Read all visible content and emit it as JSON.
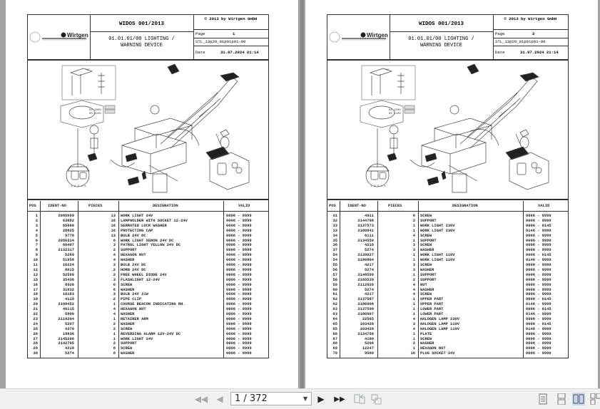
{
  "viewer": {
    "page_indicator": "1 / 372",
    "buttons": {
      "first": "first-page",
      "prev": "previous-page",
      "next": "next-page",
      "last": "last-page"
    }
  },
  "header": {
    "doc_title": "WIDOS 001/2013",
    "copyright": "© 2013 by Wirtgen GmbH",
    "section_line1": "01.01.01/00 LIGHTING /",
    "section_line2": "WARNING DEVICE",
    "page_label": "Page",
    "stl": "STL_13p20_01p01p01-00",
    "date_label": "Date",
    "date_value": "31.07.2024  21:14",
    "logo_text": "Wirtgen"
  },
  "table_headers": {
    "pos": "POS",
    "ident": "IDENT-NO",
    "pieces": "PIECES",
    "designation": "DESIGNATION",
    "valid": "VALID"
  },
  "pages": [
    {
      "page_no": "1",
      "rows": [
        [
          "1",
          "2085099",
          "13",
          "WORK LIGHT 24V",
          "0006 - 9999"
        ],
        [
          "2",
          "63882",
          "16",
          "LAMPHOLDER WITH SOCKET 12-24V",
          "0006 - 9999"
        ],
        [
          "3",
          "65068",
          "16",
          "SERRATED LOCK WASHER",
          "0006 - 9999"
        ],
        [
          "4",
          "28825",
          "16",
          "PROTECTING CAP",
          "0006 - 9999"
        ],
        [
          "5",
          "9778",
          "13",
          "BULB 24V DC",
          "0006 - 9999"
        ],
        [
          "6",
          "2050314",
          "6",
          "WORK LIGHT XENON 24V DC",
          "0006 - 9999"
        ],
        [
          "7",
          "68407",
          "3",
          "PATROL LIGHT YELLOW 24V DC",
          "0006 - 9999"
        ],
        [
          "8",
          "2132317",
          "2",
          "SUPPORT",
          "0006 - 9999"
        ],
        [
          "9",
          "5269",
          "4",
          "HEXAGON NUT",
          "0006 - 9999"
        ],
        [
          "10",
          "51958",
          "4",
          "WASHER",
          "0006 - 9999"
        ],
        [
          "11",
          "16224",
          "3",
          "BULB 24V DC",
          "0006 - 9999"
        ],
        [
          "12",
          "8015",
          "2",
          "HORN 24V DC",
          "0006 - 9999"
        ],
        [
          "13",
          "52599",
          "2",
          "FREE WHEEL DIODE 24V",
          "0006 - 9999"
        ],
        [
          "15",
          "35436",
          "3",
          "FLASHLIGHT 12-24V",
          "0006 - 9999"
        ],
        [
          "16",
          "8926",
          "6",
          "SCREW",
          "0006 - 9999"
        ],
        [
          "17",
          "31632",
          "6",
          "WASHER",
          "0006 - 9999"
        ],
        [
          "18",
          "10183",
          "3",
          "BULB 24V 21W",
          "0006 - 9999"
        ],
        [
          "19",
          "4119",
          "2",
          "PIPE CLIP",
          "0006 - 9999"
        ],
        [
          "20",
          "2108452",
          "1",
          "COURSE BEACON INDICATING RH.",
          "0006 - 9999"
        ],
        [
          "21",
          "46115",
          "4",
          "HEXAGON NUT",
          "0006 - 9999"
        ],
        [
          "22",
          "5800",
          "4",
          "WASHER",
          "0006 - 9999"
        ],
        [
          "23",
          "2119204",
          "1",
          "RETAINER ARM",
          "0006 - 9999"
        ],
        [
          "24",
          "5207",
          "2",
          "WASHER",
          "0006 - 9999"
        ],
        [
          "25",
          "4370",
          "2",
          "SCREW",
          "0006 - 9999"
        ],
        [
          "26",
          "19836",
          "1",
          "REVERSING ALARM 12V-24V DC",
          "0006 - 9999"
        ],
        [
          "27",
          "2145206",
          "1",
          "WORK LIGHT 24V",
          "0006 - 9999"
        ],
        [
          "28",
          "2142705",
          "2",
          "SUPPORT",
          "0006 - 9999"
        ],
        [
          "29",
          "4218",
          "8",
          "SCREW",
          "0006 - 9999"
        ],
        [
          "30",
          "5274",
          "8",
          "WASHER",
          "0006 - 9999"
        ]
      ]
    },
    {
      "page_no": "2",
      "rows": [
        [
          "31",
          "4911",
          "6",
          "SCREW",
          "0006 - 9999"
        ],
        [
          "32",
          "2144798",
          "2",
          "SUPPORT",
          "0006 - 9999"
        ],
        [
          "33",
          "2137573",
          "1",
          "WORK LIGHT 230V",
          "0006 - 0145"
        ],
        [
          "33",
          "2180841",
          "1",
          "WORK LIGHT 230V",
          "0146 - 9999"
        ],
        [
          "34",
          "6111",
          "4",
          "SCREW",
          "0006 - 9999"
        ],
        [
          "35",
          "2134550",
          "1",
          "SUPPORT",
          "0006 - 9999"
        ],
        [
          "36",
          "4218",
          "3",
          "SCREW",
          "0006 - 9999"
        ],
        [
          "37",
          "5274",
          "3",
          "WASHER",
          "0006 - 9999"
        ],
        [
          "54",
          "2139027",
          "1",
          "WORK LIGHT 110V",
          "0006 - 0145"
        ],
        [
          "54",
          "2180804",
          "1",
          "WORK LIGHT 110V",
          "0146 - 9999"
        ],
        [
          "55",
          "4217",
          "3",
          "SCREW",
          "0006 - 9999"
        ],
        [
          "56",
          "5274",
          "3",
          "WASHER",
          "0006 - 9999"
        ],
        [
          "57",
          "2148599",
          "1",
          "SUPPORT",
          "0006 - 9999"
        ],
        [
          "58",
          "2165539",
          "2",
          "SUPPORT",
          "0006 - 9999"
        ],
        [
          "59",
          "2112628",
          "4",
          "NUT",
          "0006 - 9999"
        ],
        [
          "60",
          "5274",
          "4",
          "WASHER",
          "0006 - 9999"
        ],
        [
          "61",
          "4217",
          "4",
          "SCREW",
          "0006 - 9999"
        ],
        [
          "62",
          "2137587",
          "1",
          "UPPER PART",
          "0006 - 0145"
        ],
        [
          "62",
          "2180906",
          "1",
          "UPPER PART",
          "0146 - 9999"
        ],
        [
          "63",
          "2137590",
          "1",
          "LOWER PART",
          "0006 - 0145"
        ],
        [
          "63",
          "2180907",
          "1",
          "LOWER PART",
          "0146 - 9999"
        ],
        [
          "64",
          "22565",
          "4",
          "HALOGEN LAMP 230V",
          "0006 - 9999"
        ],
        [
          "65",
          "103428",
          "3",
          "HALOGEN LAMP 110V",
          "0006 - 0145"
        ],
        [
          "65",
          "103428",
          "4",
          "HALOGEN LAMP 110V",
          "0146 - 9999"
        ],
        [
          "66",
          "2134756",
          "1",
          "PLATE",
          "0006 - 9999"
        ],
        [
          "67",
          "4180",
          "1",
          "SCREW",
          "0006 - 9999"
        ],
        [
          "68",
          "5206",
          "2",
          "WASHER",
          "0006 - 9999"
        ],
        [
          "69",
          "12247",
          "1",
          "HEXAGON NUT",
          "0006 - 9999"
        ],
        [
          "70",
          "9560",
          "16",
          "PLUG SOCKET 24V",
          "0006 - 9999"
        ]
      ]
    }
  ],
  "diagram_labels": {
    "view_x": "\"X\"",
    "v230": "64 230V",
    "v110": "65 110V"
  }
}
